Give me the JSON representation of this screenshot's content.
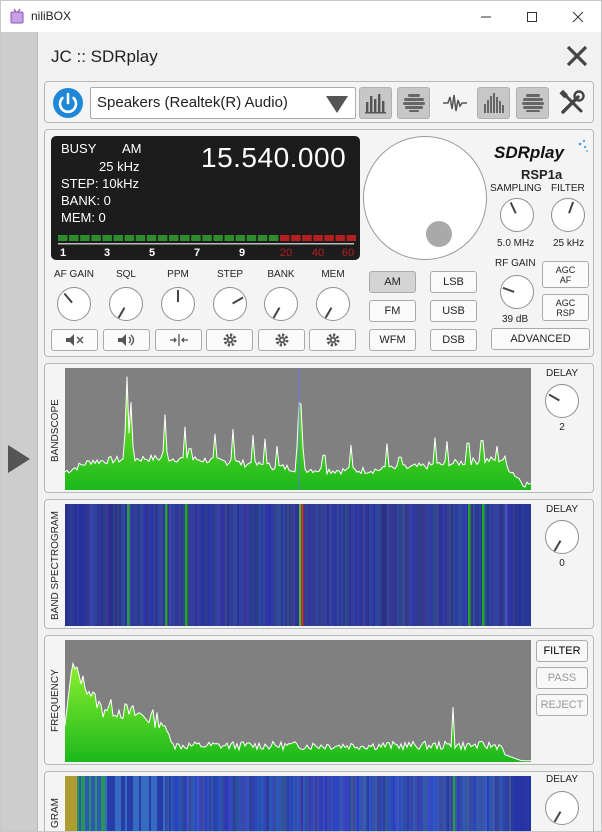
{
  "window": {
    "title": "niliBOX",
    "controls": [
      "minimize",
      "maximize",
      "close"
    ]
  },
  "panel": {
    "title": "JC :: SDRplay"
  },
  "toolbar": {
    "device": "Speakers (Realtek(R) Audio)",
    "buttons": [
      "power-icon",
      "spectrum-bars-icon",
      "waterfall-icon",
      "waveform-icon",
      "equalizer-bars-icon",
      "stack-icon",
      "tools-icon"
    ]
  },
  "lcd": {
    "busy": "BUSY",
    "mode": "AM",
    "bandwidth": "25 kHz",
    "frequency": "15.540.000",
    "step": "STEP: 10kHz",
    "bank": "BANK: 0",
    "mem": "MEM: 0",
    "meter_scale": [
      "1",
      "3",
      "5",
      "7",
      "9",
      "20",
      "40",
      "60"
    ],
    "signal_level_segments": 21,
    "colors": {
      "green": "#2e8b2e",
      "red": "#b42020"
    }
  },
  "sdr": {
    "brand": "SDRplay",
    "model": "RSP1a",
    "sampling_label": "SAMPLING",
    "sampling_value": "5.0 MHz",
    "filter_label": "FILTER",
    "filter_value": "25 kHz",
    "rfgain_label": "RF GAIN",
    "rfgain_value": "39 dB",
    "agc_af_line1": "AGC",
    "agc_af_line2": "AF",
    "agc_rsp_line1": "AGC",
    "agc_rsp_line2": "RSP",
    "advanced": "ADVANCED"
  },
  "knobs": {
    "af_gain": "AF GAIN",
    "sql": "SQL",
    "ppm": "PPM",
    "step": "STEP",
    "bank": "BANK",
    "mem": "MEM"
  },
  "modes": {
    "am": "AM",
    "fm": "FM",
    "wfm": "WFM",
    "lsb": "LSB",
    "usb": "USB",
    "dsb": "DSB",
    "selected": "AM"
  },
  "bandscope": {
    "label": "BANDSCOPE",
    "delay_label": "DELAY",
    "delay_value": "2"
  },
  "spectrogram": {
    "label": "BAND SPECTROGRAM",
    "delay_label": "DELAY",
    "delay_value": "0"
  },
  "frequency": {
    "label": "FREQUENCY",
    "filter": "FILTER",
    "pass": "PASS",
    "reject": "REJECT"
  },
  "gram": {
    "label": "GRAM",
    "delay_label": "DELAY"
  }
}
